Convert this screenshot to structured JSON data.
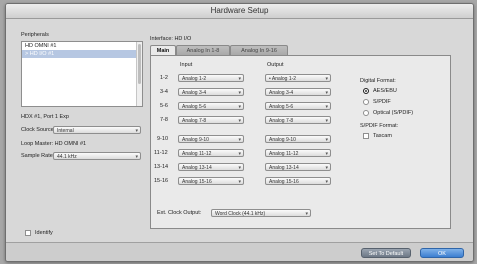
{
  "window": {
    "title": "Hardware Setup"
  },
  "left": {
    "peripherals_label": "Peripherals",
    "peripherals": [
      {
        "label": "HD OMNI #1",
        "selected": false
      },
      {
        "label": "> HD I/O #1",
        "selected": true
      }
    ],
    "device_info": "HDX #1, Port 1 Exp",
    "clock_source_label": "Clock Source:",
    "clock_source_value": "Internal",
    "loop_master": "Loop Master: HD OMNI #1",
    "sample_rate_label": "Sample Rate:",
    "sample_rate_value": "44.1 kHz",
    "identify_label": "Identify"
  },
  "interface": {
    "label": "Interface: HD I/O",
    "tabs": [
      {
        "label": "Main",
        "active": true
      },
      {
        "label": "Analog In 1-8",
        "active": false
      },
      {
        "label": "Analog In 9-16",
        "active": false
      }
    ]
  },
  "main": {
    "input_header": "Input",
    "output_header": "Output",
    "rows": [
      {
        "channel": "1-2",
        "input": "Analog 1-2",
        "output": "• Analog 1-2"
      },
      {
        "channel": "3-4",
        "input": "Analog 3-4",
        "output": "Analog 3-4"
      },
      {
        "channel": "5-6",
        "input": "Analog 5-6",
        "output": "Analog 5-6"
      },
      {
        "channel": "7-8",
        "input": "Analog 7-8",
        "output": "Analog 7-8"
      },
      {
        "channel": "9-10",
        "input": "Analog 9-10",
        "output": "Analog 9-10"
      },
      {
        "channel": "11-12",
        "input": "Analog 11-12",
        "output": "Analog 11-12"
      },
      {
        "channel": "13-14",
        "input": "Analog 13-14",
        "output": "Analog 13-14"
      },
      {
        "channel": "15-16",
        "input": "Analog 15-16",
        "output": "Analog 15-16"
      }
    ],
    "digital_format_label": "Digital Format:",
    "digital_format_options": [
      {
        "label": "AES/EBU",
        "selected": true
      },
      {
        "label": "S/PDIF",
        "selected": false
      },
      {
        "label": "Optical (S/PDIF)",
        "selected": false
      }
    ],
    "spdif_format_label": "S/PDIF Format:",
    "tascam_label": "Tascam",
    "ext_clock_label": "Ext. Clock Output:",
    "ext_clock_value": "Word Clock (44.1 kHz)"
  },
  "buttons": {
    "set_default": "Set To Default",
    "ok": "OK"
  },
  "icons": {
    "dropdown": "chevron-down-icon",
    "scrollbar": "scrollbar-thumb"
  }
}
